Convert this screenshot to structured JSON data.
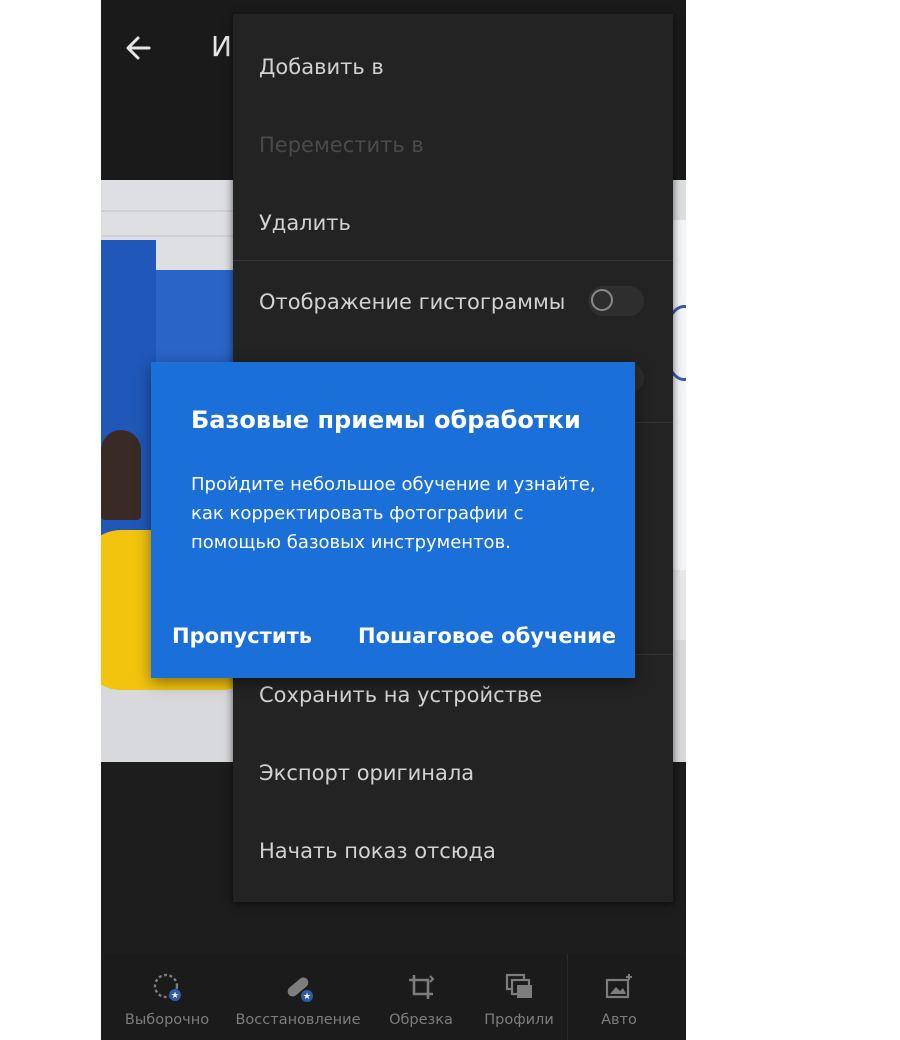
{
  "header": {
    "title_peek": "И"
  },
  "menu": {
    "items": [
      {
        "label": "Добавить в",
        "enabled": true
      },
      {
        "label": "Переместить в",
        "enabled": false
      },
      {
        "label": "Удалить",
        "enabled": true
      },
      {
        "label": "Отображение гистограммы",
        "toggle": false
      },
      {
        "label": "Сохранить на устройстве",
        "enabled": true
      },
      {
        "label": "Экспорт оригинала",
        "enabled": true
      },
      {
        "label": "Начать показ отсюда",
        "enabled": true
      }
    ]
  },
  "dialog": {
    "title": "Базовые приемы обработки",
    "body": "Пройдите небольшое обучение и узнайте, как корректировать фотографии с помощью базовых инструментов.",
    "skip_label": "Пропустить",
    "tutorial_label": "Пошаговое обучение",
    "background_color": "#1a6fd8"
  },
  "toolbar": {
    "tools": [
      {
        "label": "Выборочно",
        "icon": "selective-icon"
      },
      {
        "label": "Восстановление",
        "icon": "healing-bandage-icon"
      },
      {
        "label": "Обрезка",
        "icon": "crop-icon"
      },
      {
        "label": "Профили",
        "icon": "profiles-icon"
      },
      {
        "label": "Авто",
        "icon": "auto-icon"
      }
    ]
  }
}
